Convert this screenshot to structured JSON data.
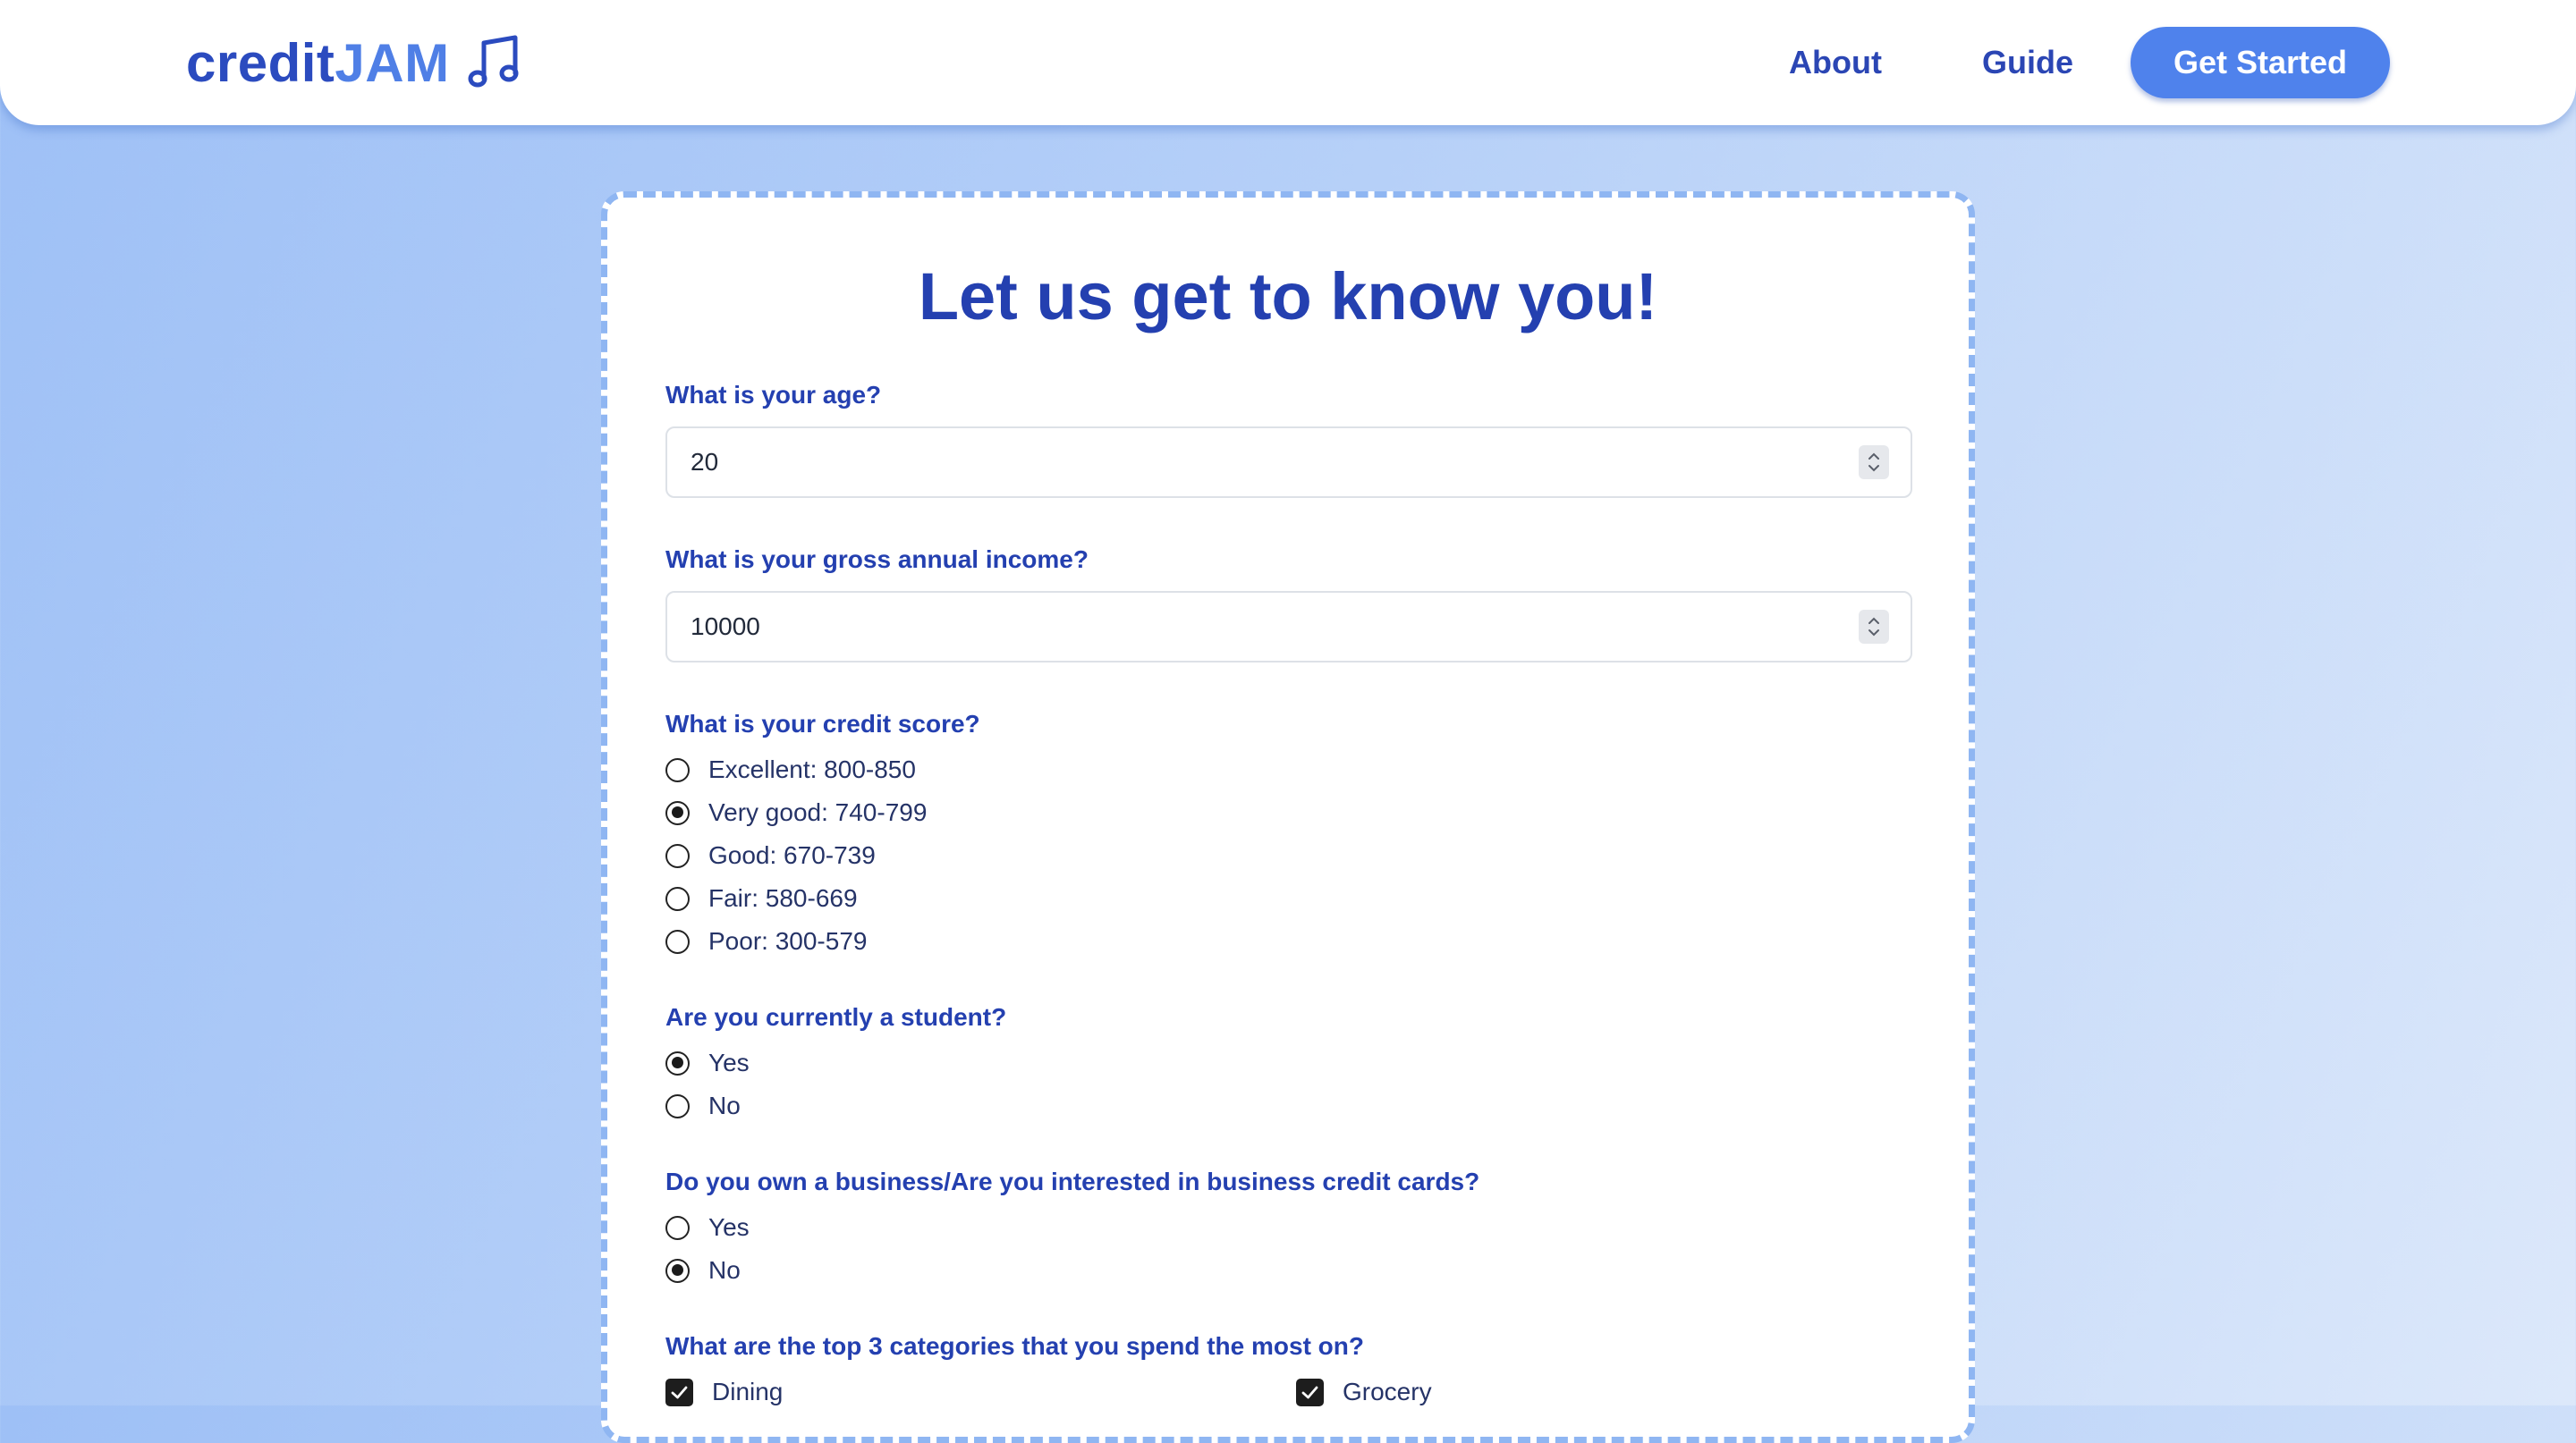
{
  "header": {
    "logo_part1": "credit",
    "logo_part2": "JAM",
    "logo_icon": "music-note-icon",
    "nav_about": "About",
    "nav_guide": "Guide",
    "cta_label": "Get Started"
  },
  "form": {
    "title": "Let us get to know you!",
    "age": {
      "label": "What is your age?",
      "value": "20"
    },
    "income": {
      "label": "What is your gross annual income?",
      "value": "10000"
    },
    "credit_score": {
      "label": "What is your credit score?",
      "options": [
        {
          "label": "Excellent: 800-850",
          "selected": false
        },
        {
          "label": "Very good: 740-799",
          "selected": true
        },
        {
          "label": "Good: 670-739",
          "selected": false
        },
        {
          "label": "Fair: 580-669",
          "selected": false
        },
        {
          "label": "Poor: 300-579",
          "selected": false
        }
      ]
    },
    "student": {
      "label": "Are you currently a student?",
      "options": [
        {
          "label": "Yes",
          "selected": true
        },
        {
          "label": "No",
          "selected": false
        }
      ]
    },
    "business": {
      "label": "Do you own a business/Are you interested in business credit cards?",
      "options": [
        {
          "label": "Yes",
          "selected": false
        },
        {
          "label": "No",
          "selected": true
        }
      ]
    },
    "categories": {
      "label": "What are the top 3 categories that you spend the most on?",
      "options": [
        {
          "label": "Dining",
          "checked": true
        },
        {
          "label": "Grocery",
          "checked": true
        }
      ]
    }
  },
  "colors": {
    "brand_dark": "#2440b0",
    "brand_light": "#4f82ec",
    "card_border": "#8fb6f2"
  }
}
